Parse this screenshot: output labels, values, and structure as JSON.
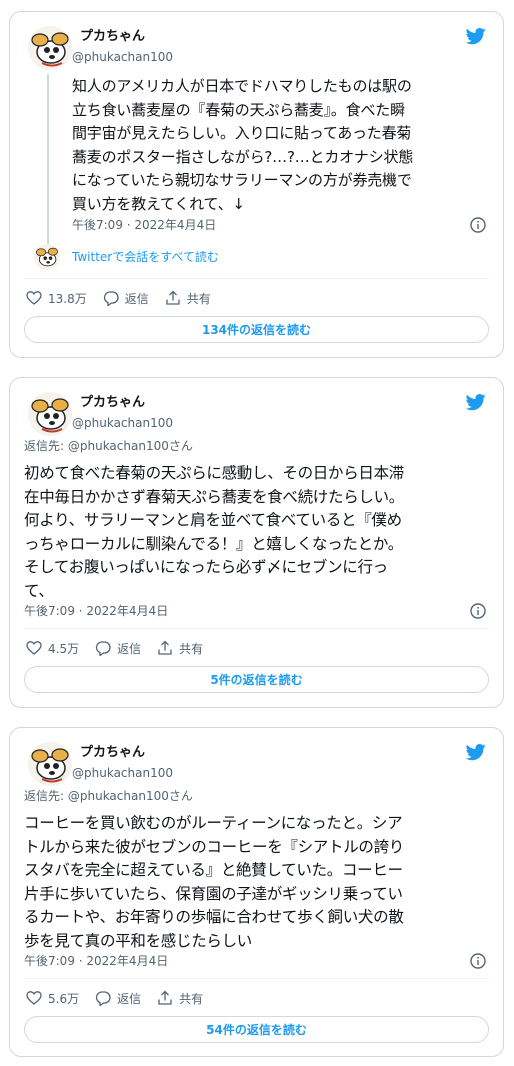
{
  "icons": {
    "avatar": "dog-cartoon-avatar",
    "brand": "twitter-bird-icon",
    "info": "info-icon",
    "like": "heart-icon",
    "reply": "reply-bubble-icon",
    "share": "share-icon"
  },
  "colors": {
    "accent": "#1d9bf0",
    "muted": "#536471",
    "border": "#cfd9de"
  },
  "tweets": [
    {
      "name": "プカちゃん",
      "handle": "@phukachan100",
      "reply_to": "",
      "lines": [
        "知人のアメリカ人が日本でドハマりしたものは駅の",
        "立ち食い蕎麦屋の『春菊の天ぷら蕎麦』。食べた瞬",
        "間宇宙が見えたらしい。入り口に貼ってあった春菊",
        "蕎麦のポスター指さしながら?…?…とカオナシ状態",
        "になっていたら親切なサラリーマンの方が券売機で",
        "買い方を教えてくれて、↓"
      ],
      "timestamp": "午後7:09 · 2022年4月4日",
      "conversation_link": "Twitterで会話をすべて読む",
      "likes": "13.8万",
      "reply_label": "返信",
      "share_label": "共有",
      "replies_button": "134件の返信を読む"
    },
    {
      "name": "プカちゃん",
      "handle": "@phukachan100",
      "reply_to_prefix": "返信先: ",
      "reply_to": "@phukachan100さん",
      "lines": [
        "初めて食べた春菊の天ぷらに感動し、その日から日本滞",
        "在中毎日かかさず春菊天ぷら蕎麦を食べ続けたらしい。",
        "何より、サラリーマンと肩を並べて食べていると『僕め",
        "っちゃローカルに馴染んでる！』と嬉しくなったとか。",
        "そしてお腹いっぱいになったら必ず〆にセブンに行っ",
        "て、"
      ],
      "timestamp": "午後7:09 · 2022年4月4日",
      "likes": "4.5万",
      "reply_label": "返信",
      "share_label": "共有",
      "replies_button": "5件の返信を読む"
    },
    {
      "name": "プカちゃん",
      "handle": "@phukachan100",
      "reply_to_prefix": "返信先: ",
      "reply_to": "@phukachan100さん",
      "lines": [
        "コーヒーを買い飲むのがルーティーンになったと。シア",
        "トルから来た彼がセブンのコーヒーを『シアトルの誇り",
        "スタバを完全に超えている』と絶賛していた。コーヒー",
        "片手に歩いていたら、保育園の子達がギッシリ乗ってい",
        "るカートや、お年寄りの歩幅に合わせて歩く飼い犬の散",
        "歩を見て真の平和を感じたらしい"
      ],
      "timestamp": "午後7:09 · 2022年4月4日",
      "likes": "5.6万",
      "reply_label": "返信",
      "share_label": "共有",
      "replies_button": "54件の返信を読む"
    }
  ]
}
